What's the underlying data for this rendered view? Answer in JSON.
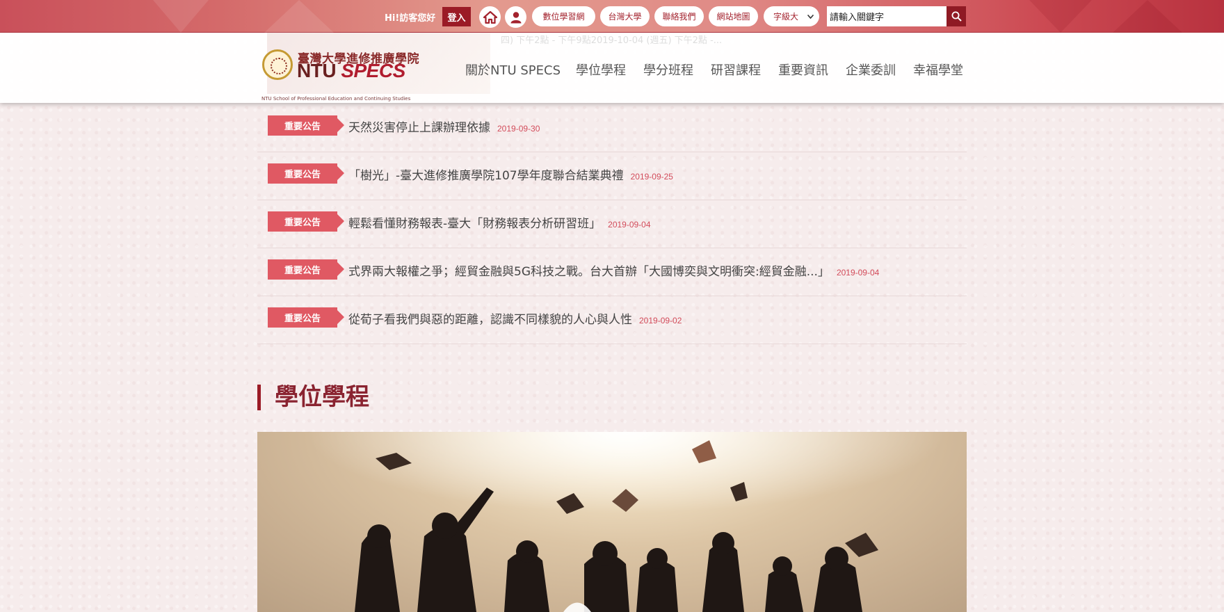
{
  "topbar": {
    "greeting": "Hi!訪客您好",
    "login_label": "登入",
    "home_icon": "home-icon",
    "user_icon": "user-icon",
    "links": [
      "數位學習網",
      "台灣大學",
      "聯絡我們",
      "網站地圖"
    ],
    "font_size_select": "字級大",
    "search_placeholder": "請輸入關鍵字",
    "search_icon": "search-icon"
  },
  "header": {
    "logo_cn": "臺灣大學進修推廣學院",
    "logo_en_a": "NTU",
    "logo_en_b": "SPECS",
    "logo_sub": "NTU School of Professional Education and Continuing Studies",
    "ghost_text": "四) 下午2點 - 下午9點2019-10-04 (週五) 下午2點 -...",
    "nav": [
      "關於NTU SPECS",
      "學位學程",
      "學分班程",
      "研習課程",
      "重要資訊",
      "企業委訓",
      "幸福學堂"
    ]
  },
  "announcements": [
    {
      "tag": "重要公告",
      "title": "天然災害停止上課辦理依據",
      "date": "2019-09-30"
    },
    {
      "tag": "重要公告",
      "title": "「樹光」-臺大進修推廣學院107學年度聯合結業典禮",
      "date": "2019-09-25"
    },
    {
      "tag": "重要公告",
      "title": "輕鬆看懂財務報表-臺大「財務報表分析研習班」",
      "date": "2019-09-04"
    },
    {
      "tag": "重要公告",
      "title": "式界兩大報權之爭；經貿金融與5G科技之戰。台大首辦「大國博奕與文明衝突:經貿金融...」",
      "date": "2019-09-04"
    },
    {
      "tag": "重要公告",
      "title": "從荀子看我們與惡的距離，認識不同樣貌的人心與人性",
      "date": "2019-09-02"
    }
  ],
  "section": {
    "title": "學位學程",
    "hero_image": "graduates-throwing-caps"
  },
  "colors": {
    "brand_red": "#9b1b26",
    "tag_red": "#e05963",
    "date_red": "#d24b5a",
    "section_title": "#8a2330"
  }
}
